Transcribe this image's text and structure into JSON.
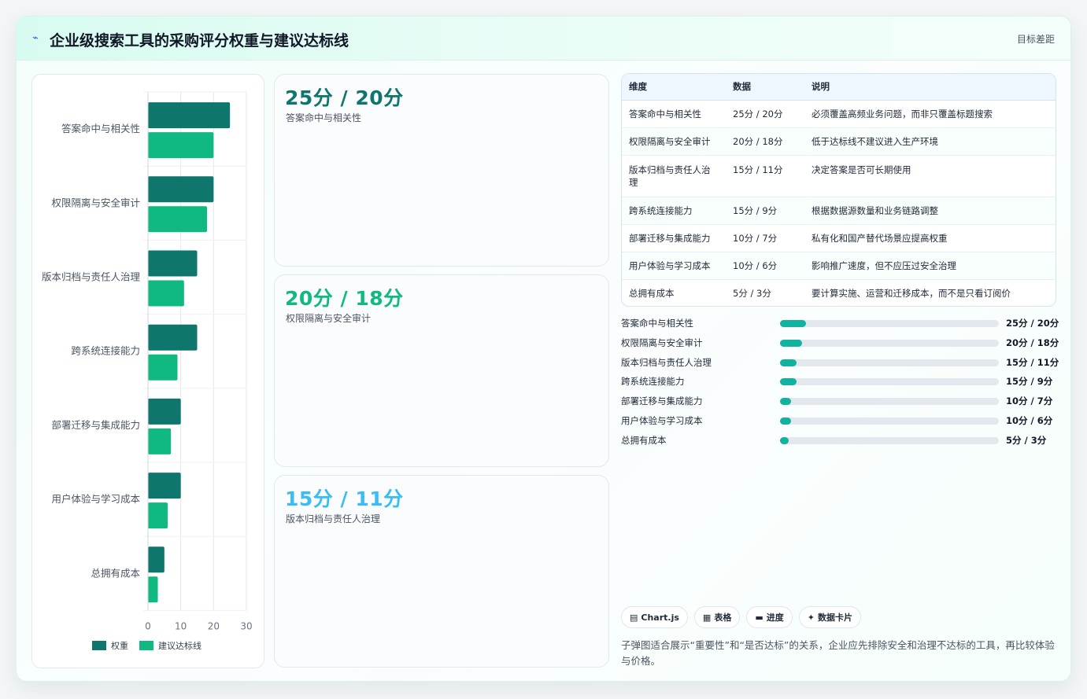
{
  "header": {
    "logo_icon": "sparkle-icon",
    "title": "企业级搜索工具的采购评分权重与建议达标线",
    "right_label": "目标差距"
  },
  "chart_data": {
    "type": "bar",
    "orientation": "horizontal",
    "categories": [
      "答案命中与相关性",
      "权限隔离与安全审计",
      "版本归档与责任人治理",
      "跨系统连接能力",
      "部署迁移与集成能力",
      "用户体验与学习成本",
      "总拥有成本"
    ],
    "series": [
      {
        "name": "权重",
        "color": "#0f766e",
        "values": [
          25,
          20,
          15,
          15,
          10,
          10,
          5
        ]
      },
      {
        "name": "建议达标线",
        "color": "#10b981",
        "values": [
          20,
          18,
          11,
          9,
          7,
          6,
          3
        ]
      }
    ],
    "xlim": [
      0,
      30
    ],
    "xticks": [
      0,
      10,
      20,
      30
    ],
    "grid": true,
    "legend_position": "bottom"
  },
  "cards": [
    {
      "value": "25分 / 20分",
      "label": "答案命中与相关性",
      "color": "#0f766e"
    },
    {
      "value": "20分 / 18分",
      "label": "权限隔离与安全审计",
      "color": "#10b981"
    },
    {
      "value": "15分 / 11分",
      "label": "版本归档与责任人治理",
      "color": "#38bdf8"
    }
  ],
  "table": {
    "headers": [
      "维度",
      "数据",
      "说明"
    ],
    "rows": [
      [
        "答案命中与相关性",
        "25分 / 20分",
        "必须覆盖高频业务问题，而非只覆盖标题搜索"
      ],
      [
        "权限隔离与安全审计",
        "20分 / 18分",
        "低于达标线不建议进入生产环境"
      ],
      [
        "版本归档与责任人治理",
        "15分 / 11分",
        "决定答案是否可长期使用"
      ],
      [
        "跨系统连接能力",
        "15分 / 9分",
        "根据数据源数量和业务链路调整"
      ],
      [
        "部署迁移与集成能力",
        "10分 / 7分",
        "私有化和国产替代场景应提高权重"
      ],
      [
        "用户体验与学习成本",
        "10分 / 6分",
        "影响推广速度，但不应压过安全治理"
      ],
      [
        "总拥有成本",
        "5分 / 3分",
        "要计算实施、运营和迁移成本，而不是只看订阅价"
      ]
    ]
  },
  "progress": [
    {
      "label": "答案命中与相关性",
      "value": "25分 / 20分",
      "fraction": 0.12
    },
    {
      "label": "权限隔离与安全审计",
      "value": "20分 / 18分",
      "fraction": 0.1
    },
    {
      "label": "版本归档与责任人治理",
      "value": "15分 / 11分",
      "fraction": 0.075
    },
    {
      "label": "跨系统连接能力",
      "value": "15分 / 9分",
      "fraction": 0.075
    },
    {
      "label": "部署迁移与集成能力",
      "value": "10分 / 7分",
      "fraction": 0.05
    },
    {
      "label": "用户体验与学习成本",
      "value": "10分 / 6分",
      "fraction": 0.05
    },
    {
      "label": "总拥有成本",
      "value": "5分 / 3分",
      "fraction": 0.04
    }
  ],
  "chips": [
    {
      "icon": "chart-icon",
      "glyph": "▤",
      "label": "Chart.js"
    },
    {
      "icon": "table-icon",
      "glyph": "▦",
      "label": "表格"
    },
    {
      "icon": "progress-icon",
      "glyph": "▬",
      "label": "进度"
    },
    {
      "icon": "sparkle-icon",
      "glyph": "✦",
      "label": "数据卡片"
    }
  ],
  "note": "子弹图适合展示“重要性”和“是否达标”的关系，企业应先排除安全和治理不达标的工具，再比较体验与价格。"
}
